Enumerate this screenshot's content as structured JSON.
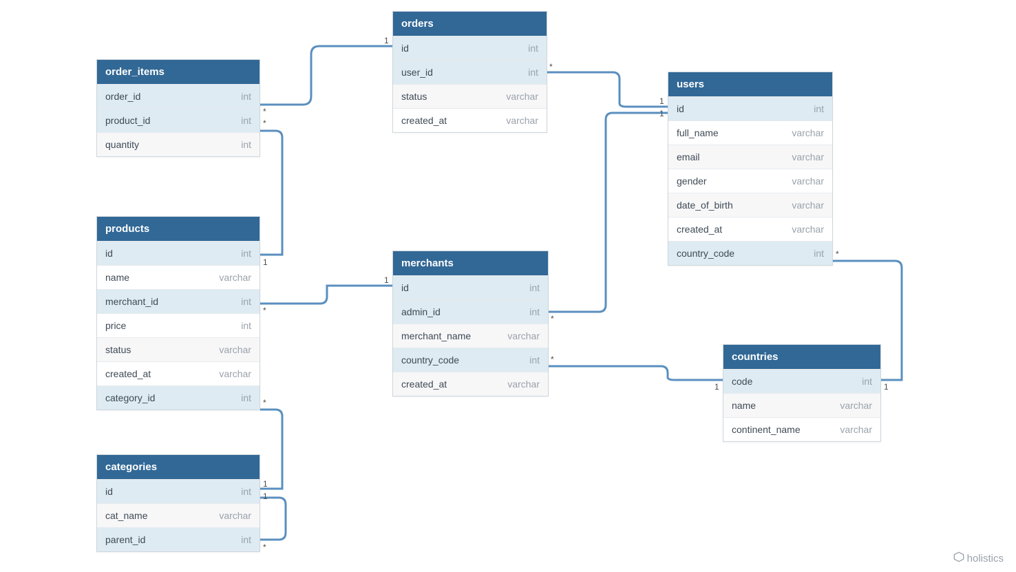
{
  "tables": {
    "order_items": {
      "title": "order_items",
      "fields": [
        {
          "name": "order_id",
          "type": "int",
          "hl": true
        },
        {
          "name": "product_id",
          "type": "int",
          "hl": true
        },
        {
          "name": "quantity",
          "type": "int",
          "hl": false
        }
      ]
    },
    "orders": {
      "title": "orders",
      "fields": [
        {
          "name": "id",
          "type": "int",
          "hl": true
        },
        {
          "name": "user_id",
          "type": "int",
          "hl": true
        },
        {
          "name": "status",
          "type": "varchar",
          "hl": false
        },
        {
          "name": "created_at",
          "type": "varchar",
          "hl": false
        }
      ]
    },
    "users": {
      "title": "users",
      "fields": [
        {
          "name": "id",
          "type": "int",
          "hl": true
        },
        {
          "name": "full_name",
          "type": "varchar",
          "hl": false
        },
        {
          "name": "email",
          "type": "varchar",
          "hl": false
        },
        {
          "name": "gender",
          "type": "varchar",
          "hl": false
        },
        {
          "name": "date_of_birth",
          "type": "varchar",
          "hl": false
        },
        {
          "name": "created_at",
          "type": "varchar",
          "hl": false
        },
        {
          "name": "country_code",
          "type": "int",
          "hl": true
        }
      ]
    },
    "products": {
      "title": "products",
      "fields": [
        {
          "name": "id",
          "type": "int",
          "hl": true
        },
        {
          "name": "name",
          "type": "varchar",
          "hl": false
        },
        {
          "name": "merchant_id",
          "type": "int",
          "hl": true
        },
        {
          "name": "price",
          "type": "int",
          "hl": false
        },
        {
          "name": "status",
          "type": "varchar",
          "hl": false
        },
        {
          "name": "created_at",
          "type": "varchar",
          "hl": false
        },
        {
          "name": "category_id",
          "type": "int",
          "hl": true
        }
      ]
    },
    "merchants": {
      "title": "merchants",
      "fields": [
        {
          "name": "id",
          "type": "int",
          "hl": true
        },
        {
          "name": "admin_id",
          "type": "int",
          "hl": true
        },
        {
          "name": "merchant_name",
          "type": "varchar",
          "hl": false
        },
        {
          "name": "country_code",
          "type": "int",
          "hl": true
        },
        {
          "name": "created_at",
          "type": "varchar",
          "hl": false
        }
      ]
    },
    "countries": {
      "title": "countries",
      "fields": [
        {
          "name": "code",
          "type": "int",
          "hl": true
        },
        {
          "name": "name",
          "type": "varchar",
          "hl": false
        },
        {
          "name": "continent_name",
          "type": "varchar",
          "hl": false
        }
      ]
    },
    "categories": {
      "title": "categories",
      "fields": [
        {
          "name": "id",
          "type": "int",
          "hl": true
        },
        {
          "name": "cat_name",
          "type": "varchar",
          "hl": false
        },
        {
          "name": "parent_id",
          "type": "int",
          "hl": true
        }
      ]
    }
  },
  "cardinalities": {
    "c1": "1",
    "c2": "*",
    "c3": "1",
    "c4": "*",
    "c5": "*",
    "c6": "1",
    "c7": "*",
    "c8": "1",
    "c9": "*",
    "c10": "1",
    "c11": "*",
    "c12": "1",
    "c13": "*",
    "c14": "1",
    "c15": "*",
    "c16": "1",
    "c17": "1",
    "c18": "*"
  },
  "watermark": "holistics"
}
